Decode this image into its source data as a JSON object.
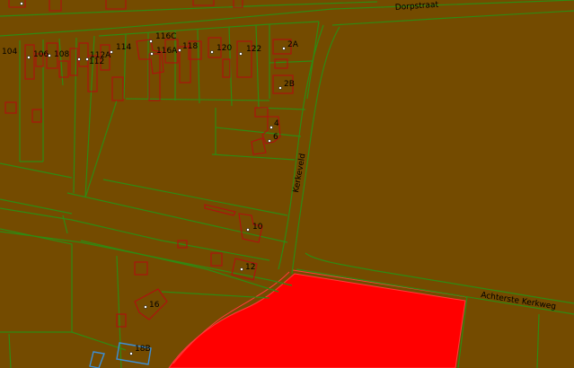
{
  "map": {
    "background_color": "#744b00",
    "parcel_line_color": "#2f8a12",
    "building_outline_color": "#b01010",
    "highlight_fill_color": "#ff0000",
    "selected_outline_color": "#3c8fd6",
    "streets": {
      "dorpstraat": "Dorpstraat",
      "kerkeveld": "Kerkeveld",
      "achterste_kerkweg": "Achterste Kerkweg"
    },
    "house_numbers": {
      "n104": "104",
      "n106": "106",
      "n108": "108",
      "n112": "112",
      "n112a": "112A",
      "n114": "114",
      "n116c": "116C",
      "n116a": "116A",
      "n118": "118",
      "n120": "120",
      "n122": "122",
      "n2a": "2A",
      "n2b": "2B",
      "n4": "4",
      "n6": "6",
      "n10": "10",
      "n12": "12",
      "n16": "16",
      "n18b": "18B"
    }
  }
}
